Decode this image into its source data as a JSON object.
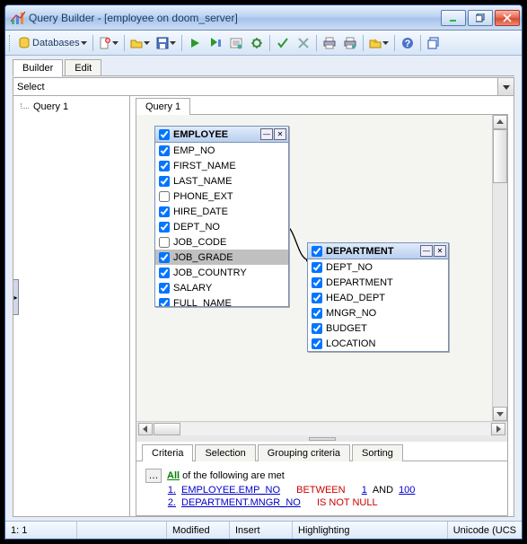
{
  "title": "Query Builder - [employee on doom_server]",
  "toolbar": {
    "databases": "Databases"
  },
  "tabs": {
    "builder": "Builder",
    "edit": "Edit"
  },
  "select_label": "Select",
  "tree": {
    "item1": "Query 1"
  },
  "inner_tab": "Query 1",
  "tables": {
    "employee": {
      "title": "EMPLOYEE",
      "fields": [
        {
          "name": "EMP_NO",
          "checked": true
        },
        {
          "name": "FIRST_NAME",
          "checked": true
        },
        {
          "name": "LAST_NAME",
          "checked": true
        },
        {
          "name": "PHONE_EXT",
          "checked": false
        },
        {
          "name": "HIRE_DATE",
          "checked": true
        },
        {
          "name": "DEPT_NO",
          "checked": true
        },
        {
          "name": "JOB_CODE",
          "checked": false
        },
        {
          "name": "JOB_GRADE",
          "checked": true,
          "selected": true
        },
        {
          "name": "JOB_COUNTRY",
          "checked": true
        },
        {
          "name": "SALARY",
          "checked": true
        },
        {
          "name": "FULL_NAME",
          "checked": true
        }
      ]
    },
    "department": {
      "title": "DEPARTMENT",
      "fields": [
        {
          "name": "DEPT_NO",
          "checked": true
        },
        {
          "name": "DEPARTMENT",
          "checked": true
        },
        {
          "name": "HEAD_DEPT",
          "checked": true
        },
        {
          "name": "MNGR_NO",
          "checked": true
        },
        {
          "name": "BUDGET",
          "checked": true
        },
        {
          "name": "LOCATION",
          "checked": true
        }
      ]
    }
  },
  "bottom_tabs": {
    "criteria": "Criteria",
    "selection": "Selection",
    "grouping": "Grouping criteria",
    "sorting": "Sorting"
  },
  "criteria": {
    "all": "All",
    "suffix": "of the following are met",
    "rows": [
      {
        "idx": "1.",
        "field": "EMPLOYEE.EMP_NO",
        "op": "BETWEEN",
        "v1": "1",
        "and": "AND",
        "v2": "100"
      },
      {
        "idx": "2.",
        "field": "DEPARTMENT.MNGR_NO",
        "op": "IS NOT NULL"
      }
    ]
  },
  "status": {
    "pos": "1:   1",
    "modified": "Modified",
    "insert": "Insert",
    "highlight": "Highlighting",
    "encoding": "Unicode (UCS"
  }
}
